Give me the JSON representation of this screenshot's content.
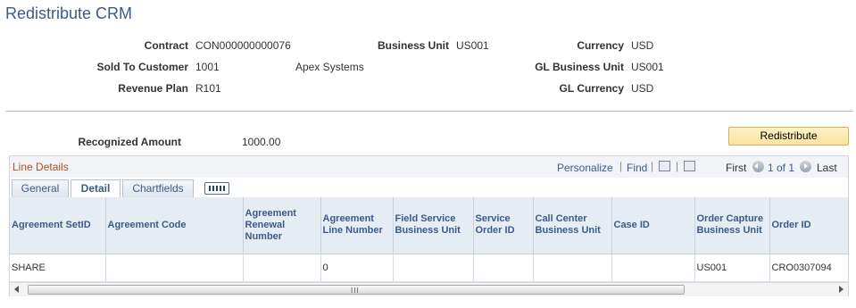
{
  "page": {
    "title": "Redistribute CRM"
  },
  "header": {
    "contract_label": "Contract",
    "contract_value": "CON000000000076",
    "business_unit_label": "Business Unit",
    "business_unit_value": "US001",
    "currency_label": "Currency",
    "currency_value": "USD",
    "sold_to_label": "Sold To Customer",
    "sold_to_value": "1001",
    "sold_to_name": "Apex Systems",
    "gl_bu_label": "GL Business Unit",
    "gl_bu_value": "US001",
    "revenue_plan_label": "Revenue Plan",
    "revenue_plan_value": "R101",
    "gl_currency_label": "GL Currency",
    "gl_currency_value": "USD"
  },
  "summary": {
    "recognized_label": "Recognized Amount",
    "recognized_value": "1000.00",
    "redistribute_label": "Redistribute"
  },
  "grid": {
    "title": "Line Details",
    "personalize": "Personalize",
    "sep": "|",
    "find": "Find",
    "first": "First",
    "range": "1 of 1",
    "last": "Last",
    "tabs": [
      "General",
      "Detail",
      "Chartfields"
    ],
    "columns": [
      "Agreement SetID",
      "Agreement Code",
      "Agreement Renewal Number",
      "Agreement Line Number",
      "Field Service Business Unit",
      "Service Order ID",
      "Call Center Business Unit",
      "Case ID",
      "Order Capture Business Unit",
      "Order ID"
    ],
    "rows": [
      [
        "SHARE",
        "",
        "",
        "0",
        "",
        "",
        "",
        "",
        "US001",
        "CRO0307094"
      ]
    ],
    "scroll_grip": "III"
  }
}
